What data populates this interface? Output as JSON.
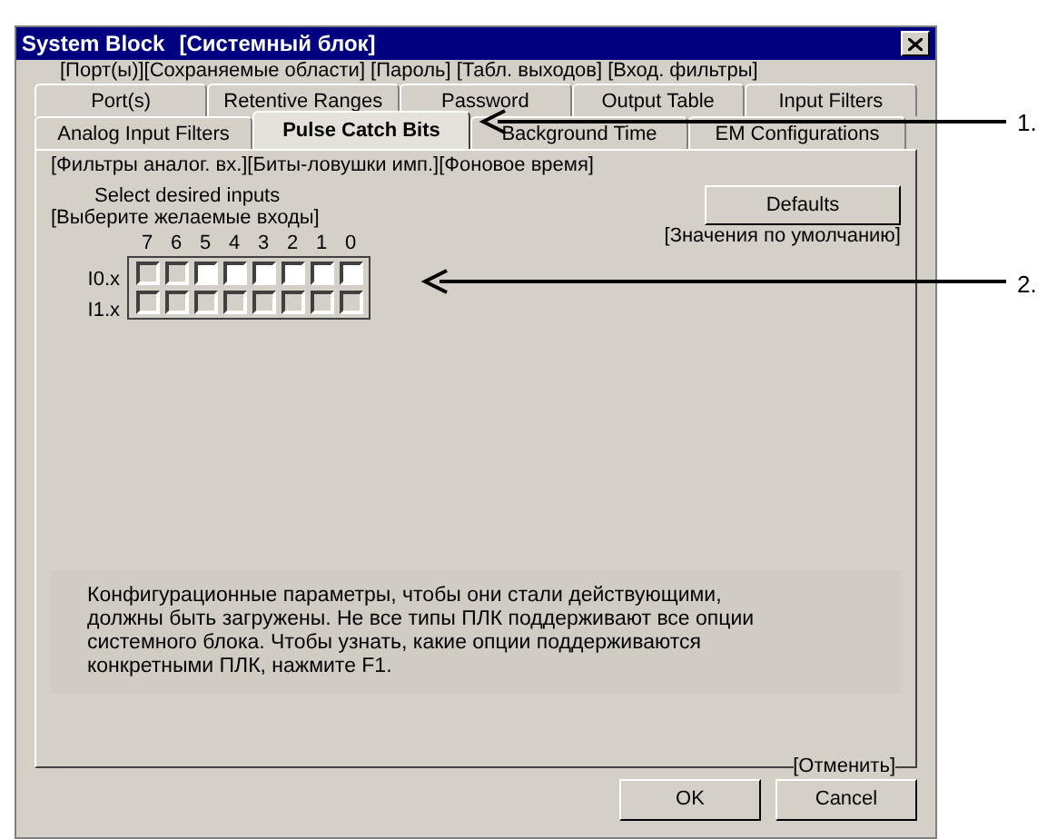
{
  "window": {
    "title": "System Block",
    "title_translation": "[Системный блок]"
  },
  "tab_translations_row1": "[Порт(ы)][Сохраняемые области] [Пароль]  [Табл. выходов] [Вход. фильтры]",
  "tab_rows": [
    [
      {
        "label": "Port(s)",
        "selected": false
      },
      {
        "label": "Retentive Ranges",
        "selected": false
      },
      {
        "label": "Password",
        "selected": false
      },
      {
        "label": "Output Table",
        "selected": false
      },
      {
        "label": "Input Filters",
        "selected": false
      }
    ],
    [
      {
        "label": "Analog Input Filters",
        "selected": false
      },
      {
        "label": "Pulse Catch Bits",
        "selected": true
      },
      {
        "label": "Background Time",
        "selected": false
      },
      {
        "label": "EM Configurations",
        "selected": false
      }
    ]
  ],
  "tab_translations_row2": "[Фильтры аналог. вх.][Биты-ловушки имп.][Фоновое время]",
  "select_label": "Select desired inputs",
  "select_translation": "[Выберите желаемые входы]",
  "defaults_button": "Defaults",
  "defaults_translation": "[Значения по умолчанию]",
  "bit_headers": [
    "7",
    "6",
    "5",
    "4",
    "3",
    "2",
    "1",
    "0"
  ],
  "input_rows": [
    {
      "label": "I0.x",
      "bits": [
        {
          "disabled": true
        },
        {
          "disabled": true
        },
        {
          "disabled": false
        },
        {
          "disabled": false
        },
        {
          "disabled": false
        },
        {
          "disabled": false
        },
        {
          "disabled": false
        },
        {
          "disabled": false
        }
      ]
    },
    {
      "label": "I1.x",
      "bits": [
        {
          "disabled": true
        },
        {
          "disabled": true
        },
        {
          "disabled": true
        },
        {
          "disabled": true
        },
        {
          "disabled": true
        },
        {
          "disabled": true
        },
        {
          "disabled": true
        },
        {
          "disabled": true
        }
      ]
    }
  ],
  "note": "Конфигурационные параметры, чтобы они стали действующими, должны быть загружены. Не все типы ПЛК поддерживают все опции системного блока. Чтобы узнать, какие опции поддерживаются конкретными ПЛК, нажмите F1.",
  "cancel_translation": "[Отменить]",
  "buttons": [
    "OK",
    "Cancel"
  ],
  "callouts": [
    "1.",
    "2."
  ]
}
